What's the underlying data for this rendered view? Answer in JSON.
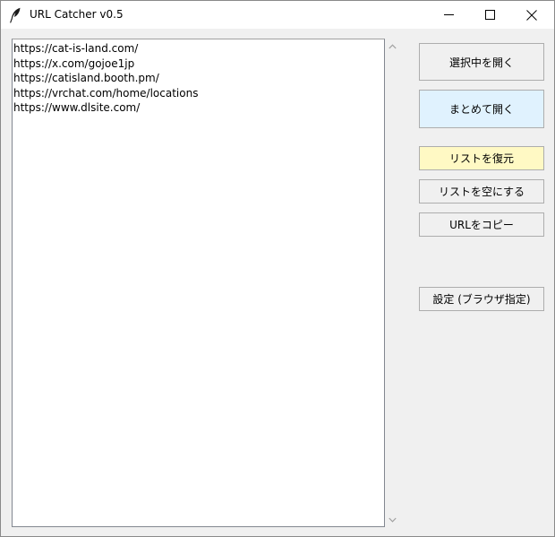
{
  "window": {
    "title": "URL Catcher v0.5",
    "icon": "feather-icon",
    "controls": {
      "minimize": "minimize-icon",
      "maximize": "maximize-icon",
      "close": "close-icon"
    }
  },
  "list": {
    "items": [
      "https://cat-is-land.com/",
      "https://x.com/gojoe1jp",
      "https://catisland.booth.pm/",
      "https://vrchat.com/home/locations",
      "https://www.dlsite.com/"
    ]
  },
  "buttons": {
    "open_selected": "選択中を開く",
    "open_all": "まとめて開く",
    "restore_list": "リストを復元",
    "clear_list": "リストを空にする",
    "copy_url": "URLをコピー",
    "settings": "設定 (ブラウザ指定)"
  },
  "colors": {
    "open_all_bg": "#e0f2fe",
    "restore_bg": "#fff9c4",
    "window_bg": "#f0f0f0"
  }
}
